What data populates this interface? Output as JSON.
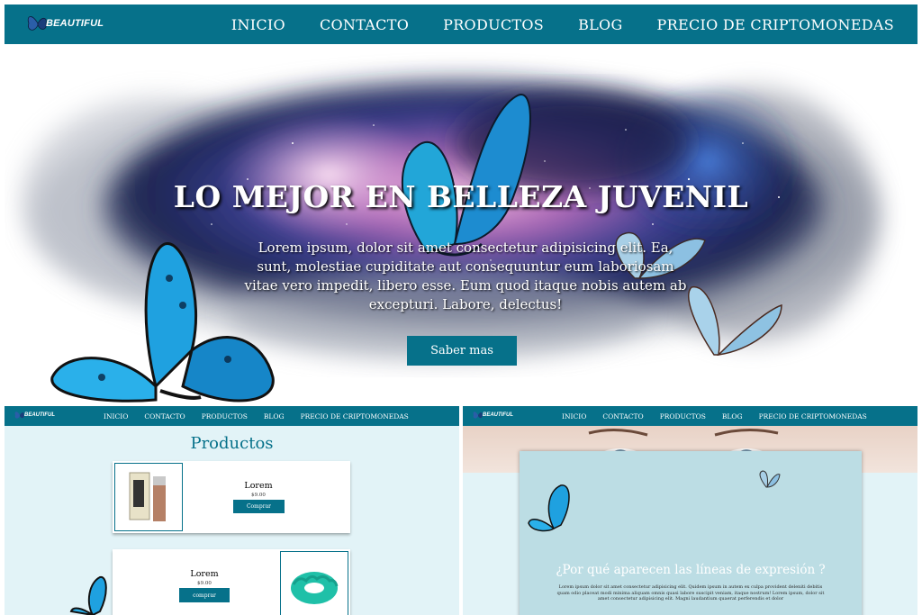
{
  "brand": {
    "name": "BEAUTIFUL"
  },
  "nav": {
    "items": [
      "INICIO",
      "CONTACTO",
      "PRODUCTOS",
      "BLOG",
      "PRECIO DE CRIPTOMONEDAS"
    ]
  },
  "hero": {
    "title": "LO MEJOR EN BELLEZA JUVENIL",
    "text": "Lorem ipsum, dolor sit amet consectetur adipisicing elit. Ea, sunt, molestiae cupiditate aut consequuntur eum laboriosam vitae vero impedit, libero esse. Eum quod itaque nobis autem ab excepturi. Labore, delectus!",
    "button": "Saber mas"
  },
  "products_page": {
    "title": "Productos",
    "products": [
      {
        "name": "Lorem",
        "price": "$9.00",
        "button": "Comprar"
      },
      {
        "name": "Lorem",
        "price": "$9.00",
        "button": "comprar"
      }
    ]
  },
  "blog_page": {
    "article_title": "¿Por qué aparecen las líneas de expresión ?",
    "article_body": "Lorem ipsum dolor sit amet consectetur adipisicing elit. Quidem ipsum in autem ex culpa provident deleniti debitis quam odio placeat modi minima aliquam omnis quasi labore suscipit veniam, itaque nostrum! Lorem ipsum, dolor sit amet consectetur adipisicing elit. Magni laudantium quaerat perferendis et dolor"
  },
  "colors": {
    "primary": "#06718a",
    "panel_bg": "#e2f3f7",
    "card_bg": "#bcdde4"
  },
  "icons": [
    "butterfly-icon"
  ]
}
